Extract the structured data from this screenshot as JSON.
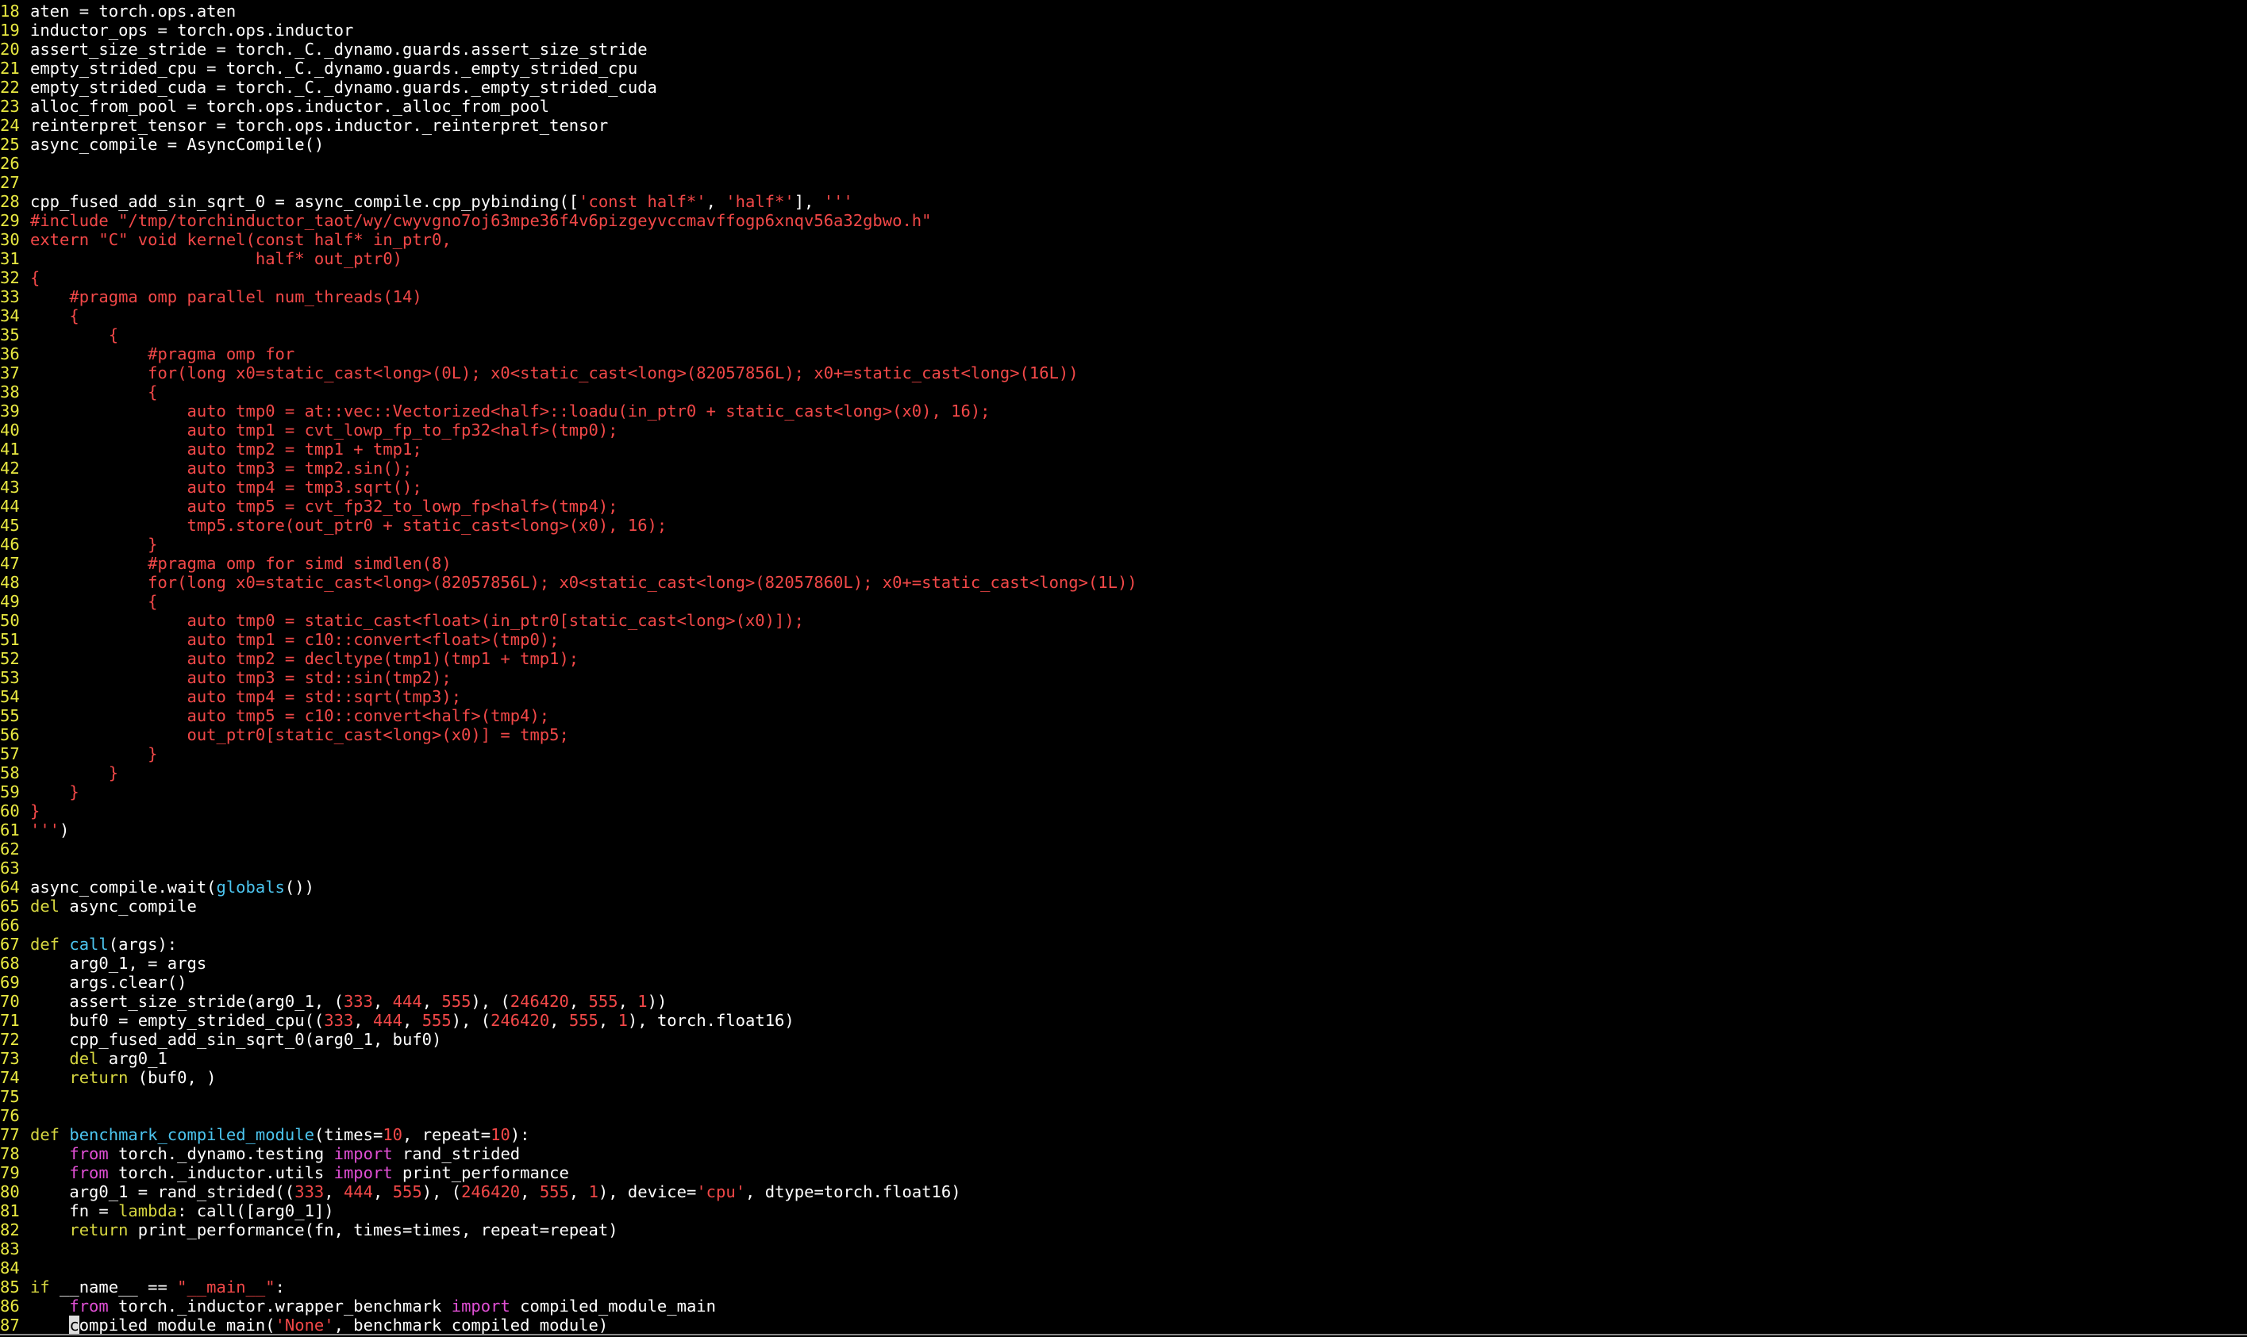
{
  "colors": {
    "background": "#000000",
    "line_number": "#e8e840",
    "default_text": "#ffffff",
    "string_literal": "#f24848",
    "number_literal": "#f24848",
    "keyword": "#d6d640",
    "import_keyword": "#e04fd4",
    "builtin": "#4cc4ee",
    "function_name": "#4cc4ee",
    "cursor": "#dcdcdc"
  },
  "editor": {
    "lines": [
      {
        "num": "18",
        "tokens": [
          {
            "t": "aten = torch.ops.aten",
            "c": "d"
          }
        ]
      },
      {
        "num": "19",
        "tokens": [
          {
            "t": "inductor_ops = torch.ops.inductor",
            "c": "d"
          }
        ]
      },
      {
        "num": "20",
        "tokens": [
          {
            "t": "assert_size_stride = torch._C._dynamo.guards.assert_size_stride",
            "c": "d"
          }
        ]
      },
      {
        "num": "21",
        "tokens": [
          {
            "t": "empty_strided_cpu = torch._C._dynamo.guards._empty_strided_cpu",
            "c": "d"
          }
        ]
      },
      {
        "num": "22",
        "tokens": [
          {
            "t": "empty_strided_cuda = torch._C._dynamo.guards._empty_strided_cuda",
            "c": "d"
          }
        ]
      },
      {
        "num": "23",
        "tokens": [
          {
            "t": "alloc_from_pool = torch.ops.inductor._alloc_from_pool",
            "c": "d"
          }
        ]
      },
      {
        "num": "24",
        "tokens": [
          {
            "t": "reinterpret_tensor = torch.ops.inductor._reinterpret_tensor",
            "c": "d"
          }
        ]
      },
      {
        "num": "25",
        "tokens": [
          {
            "t": "async_compile = AsyncCompile()",
            "c": "d"
          }
        ]
      },
      {
        "num": "26",
        "tokens": []
      },
      {
        "num": "27",
        "tokens": []
      },
      {
        "num": "28",
        "tokens": [
          {
            "t": "cpp_fused_add_sin_sqrt_0 = async_compile.cpp_pybinding([",
            "c": "d"
          },
          {
            "t": "'const half*'",
            "c": "s"
          },
          {
            "t": ", ",
            "c": "d"
          },
          {
            "t": "'half*'",
            "c": "s"
          },
          {
            "t": "], ",
            "c": "d"
          },
          {
            "t": "'''",
            "c": "s"
          }
        ]
      },
      {
        "num": "29",
        "tokens": [
          {
            "t": "#include \"/tmp/torchinductor_taot/wy/cwyvgno7oj63mpe36f4v6pizgeyvccmavffogp6xnqv56a32gbwo.h\"",
            "c": "s"
          }
        ]
      },
      {
        "num": "30",
        "tokens": [
          {
            "t": "extern \"C\" void kernel(const half* in_ptr0,",
            "c": "s"
          }
        ]
      },
      {
        "num": "31",
        "tokens": [
          {
            "t": "                       half* out_ptr0)",
            "c": "s"
          }
        ]
      },
      {
        "num": "32",
        "tokens": [
          {
            "t": "{",
            "c": "s"
          }
        ]
      },
      {
        "num": "33",
        "tokens": [
          {
            "t": "    #pragma omp parallel num_threads(14)",
            "c": "s"
          }
        ]
      },
      {
        "num": "34",
        "tokens": [
          {
            "t": "    {",
            "c": "s"
          }
        ]
      },
      {
        "num": "35",
        "tokens": [
          {
            "t": "        {",
            "c": "s"
          }
        ]
      },
      {
        "num": "36",
        "tokens": [
          {
            "t": "            #pragma omp for",
            "c": "s"
          }
        ]
      },
      {
        "num": "37",
        "tokens": [
          {
            "t": "            for(long x0=static_cast<long>(0L); x0<static_cast<long>(82057856L); x0+=static_cast<long>(16L))",
            "c": "s"
          }
        ]
      },
      {
        "num": "38",
        "tokens": [
          {
            "t": "            {",
            "c": "s"
          }
        ]
      },
      {
        "num": "39",
        "tokens": [
          {
            "t": "                auto tmp0 = at::vec::Vectorized<half>::loadu(in_ptr0 + static_cast<long>(x0), 16);",
            "c": "s"
          }
        ]
      },
      {
        "num": "40",
        "tokens": [
          {
            "t": "                auto tmp1 = cvt_lowp_fp_to_fp32<half>(tmp0);",
            "c": "s"
          }
        ]
      },
      {
        "num": "41",
        "tokens": [
          {
            "t": "                auto tmp2 = tmp1 + tmp1;",
            "c": "s"
          }
        ]
      },
      {
        "num": "42",
        "tokens": [
          {
            "t": "                auto tmp3 = tmp2.sin();",
            "c": "s"
          }
        ]
      },
      {
        "num": "43",
        "tokens": [
          {
            "t": "                auto tmp4 = tmp3.sqrt();",
            "c": "s"
          }
        ]
      },
      {
        "num": "44",
        "tokens": [
          {
            "t": "                auto tmp5 = cvt_fp32_to_lowp_fp<half>(tmp4);",
            "c": "s"
          }
        ]
      },
      {
        "num": "45",
        "tokens": [
          {
            "t": "                tmp5.store(out_ptr0 + static_cast<long>(x0), 16);",
            "c": "s"
          }
        ]
      },
      {
        "num": "46",
        "tokens": [
          {
            "t": "            }",
            "c": "s"
          }
        ]
      },
      {
        "num": "47",
        "tokens": [
          {
            "t": "            #pragma omp for simd simdlen(8)",
            "c": "s"
          }
        ]
      },
      {
        "num": "48",
        "tokens": [
          {
            "t": "            for(long x0=static_cast<long>(82057856L); x0<static_cast<long>(82057860L); x0+=static_cast<long>(1L))",
            "c": "s"
          }
        ]
      },
      {
        "num": "49",
        "tokens": [
          {
            "t": "            {",
            "c": "s"
          }
        ]
      },
      {
        "num": "50",
        "tokens": [
          {
            "t": "                auto tmp0 = static_cast<float>(in_ptr0[static_cast<long>(x0)]);",
            "c": "s"
          }
        ]
      },
      {
        "num": "51",
        "tokens": [
          {
            "t": "                auto tmp1 = c10::convert<float>(tmp0);",
            "c": "s"
          }
        ]
      },
      {
        "num": "52",
        "tokens": [
          {
            "t": "                auto tmp2 = decltype(tmp1)(tmp1 + tmp1);",
            "c": "s"
          }
        ]
      },
      {
        "num": "53",
        "tokens": [
          {
            "t": "                auto tmp3 = std::sin(tmp2);",
            "c": "s"
          }
        ]
      },
      {
        "num": "54",
        "tokens": [
          {
            "t": "                auto tmp4 = std::sqrt(tmp3);",
            "c": "s"
          }
        ]
      },
      {
        "num": "55",
        "tokens": [
          {
            "t": "                auto tmp5 = c10::convert<half>(tmp4);",
            "c": "s"
          }
        ]
      },
      {
        "num": "56",
        "tokens": [
          {
            "t": "                out_ptr0[static_cast<long>(x0)] = tmp5;",
            "c": "s"
          }
        ]
      },
      {
        "num": "57",
        "tokens": [
          {
            "t": "            }",
            "c": "s"
          }
        ]
      },
      {
        "num": "58",
        "tokens": [
          {
            "t": "        }",
            "c": "s"
          }
        ]
      },
      {
        "num": "59",
        "tokens": [
          {
            "t": "    }",
            "c": "s"
          }
        ]
      },
      {
        "num": "60",
        "tokens": [
          {
            "t": "}",
            "c": "s"
          }
        ]
      },
      {
        "num": "61",
        "tokens": [
          {
            "t": "'''",
            "c": "s"
          },
          {
            "t": ")",
            "c": "d"
          }
        ]
      },
      {
        "num": "62",
        "tokens": []
      },
      {
        "num": "63",
        "tokens": []
      },
      {
        "num": "64",
        "tokens": [
          {
            "t": "async_compile.wait(",
            "c": "d"
          },
          {
            "t": "globals",
            "c": "b"
          },
          {
            "t": "())",
            "c": "d"
          }
        ]
      },
      {
        "num": "65",
        "tokens": [
          {
            "t": "del",
            "c": "k"
          },
          {
            "t": " async_compile",
            "c": "d"
          }
        ]
      },
      {
        "num": "66",
        "tokens": []
      },
      {
        "num": "67",
        "tokens": [
          {
            "t": "def",
            "c": "k"
          },
          {
            "t": " ",
            "c": "d"
          },
          {
            "t": "call",
            "c": "f"
          },
          {
            "t": "(args):",
            "c": "d"
          }
        ]
      },
      {
        "num": "68",
        "tokens": [
          {
            "t": "    arg0_1, = args",
            "c": "d"
          }
        ]
      },
      {
        "num": "69",
        "tokens": [
          {
            "t": "    args.clear()",
            "c": "d"
          }
        ]
      },
      {
        "num": "70",
        "tokens": [
          {
            "t": "    assert_size_stride(arg0_1, (",
            "c": "d"
          },
          {
            "t": "333",
            "c": "n"
          },
          {
            "t": ", ",
            "c": "d"
          },
          {
            "t": "444",
            "c": "n"
          },
          {
            "t": ", ",
            "c": "d"
          },
          {
            "t": "555",
            "c": "n"
          },
          {
            "t": "), (",
            "c": "d"
          },
          {
            "t": "246420",
            "c": "n"
          },
          {
            "t": ", ",
            "c": "d"
          },
          {
            "t": "555",
            "c": "n"
          },
          {
            "t": ", ",
            "c": "d"
          },
          {
            "t": "1",
            "c": "n"
          },
          {
            "t": "))",
            "c": "d"
          }
        ]
      },
      {
        "num": "71",
        "tokens": [
          {
            "t": "    buf0 = empty_strided_cpu((",
            "c": "d"
          },
          {
            "t": "333",
            "c": "n"
          },
          {
            "t": ", ",
            "c": "d"
          },
          {
            "t": "444",
            "c": "n"
          },
          {
            "t": ", ",
            "c": "d"
          },
          {
            "t": "555",
            "c": "n"
          },
          {
            "t": "), (",
            "c": "d"
          },
          {
            "t": "246420",
            "c": "n"
          },
          {
            "t": ", ",
            "c": "d"
          },
          {
            "t": "555",
            "c": "n"
          },
          {
            "t": ", ",
            "c": "d"
          },
          {
            "t": "1",
            "c": "n"
          },
          {
            "t": "), torch.float16)",
            "c": "d"
          }
        ]
      },
      {
        "num": "72",
        "tokens": [
          {
            "t": "    cpp_fused_add_sin_sqrt_0(arg0_1, buf0)",
            "c": "d"
          }
        ]
      },
      {
        "num": "73",
        "tokens": [
          {
            "t": "    ",
            "c": "d"
          },
          {
            "t": "del",
            "c": "k"
          },
          {
            "t": " arg0_1",
            "c": "d"
          }
        ]
      },
      {
        "num": "74",
        "tokens": [
          {
            "t": "    ",
            "c": "d"
          },
          {
            "t": "return",
            "c": "k"
          },
          {
            "t": " (buf0, )",
            "c": "d"
          }
        ]
      },
      {
        "num": "75",
        "tokens": []
      },
      {
        "num": "76",
        "tokens": []
      },
      {
        "num": "77",
        "tokens": [
          {
            "t": "def",
            "c": "k"
          },
          {
            "t": " ",
            "c": "d"
          },
          {
            "t": "benchmark_compiled_module",
            "c": "f"
          },
          {
            "t": "(times=",
            "c": "d"
          },
          {
            "t": "10",
            "c": "n"
          },
          {
            "t": ", repeat=",
            "c": "d"
          },
          {
            "t": "10",
            "c": "n"
          },
          {
            "t": "):",
            "c": "d"
          }
        ]
      },
      {
        "num": "78",
        "tokens": [
          {
            "t": "    ",
            "c": "d"
          },
          {
            "t": "from",
            "c": "i"
          },
          {
            "t": " torch._dynamo.testing ",
            "c": "d"
          },
          {
            "t": "import",
            "c": "i"
          },
          {
            "t": " rand_strided",
            "c": "d"
          }
        ]
      },
      {
        "num": "79",
        "tokens": [
          {
            "t": "    ",
            "c": "d"
          },
          {
            "t": "from",
            "c": "i"
          },
          {
            "t": " torch._inductor.utils ",
            "c": "d"
          },
          {
            "t": "import",
            "c": "i"
          },
          {
            "t": " print_performance",
            "c": "d"
          }
        ]
      },
      {
        "num": "80",
        "tokens": [
          {
            "t": "    arg0_1 = rand_strided((",
            "c": "d"
          },
          {
            "t": "333",
            "c": "n"
          },
          {
            "t": ", ",
            "c": "d"
          },
          {
            "t": "444",
            "c": "n"
          },
          {
            "t": ", ",
            "c": "d"
          },
          {
            "t": "555",
            "c": "n"
          },
          {
            "t": "), (",
            "c": "d"
          },
          {
            "t": "246420",
            "c": "n"
          },
          {
            "t": ", ",
            "c": "d"
          },
          {
            "t": "555",
            "c": "n"
          },
          {
            "t": ", ",
            "c": "d"
          },
          {
            "t": "1",
            "c": "n"
          },
          {
            "t": "), device=",
            "c": "d"
          },
          {
            "t": "'cpu'",
            "c": "s"
          },
          {
            "t": ", dtype=torch.float16)",
            "c": "d"
          }
        ]
      },
      {
        "num": "81",
        "tokens": [
          {
            "t": "    fn = ",
            "c": "d"
          },
          {
            "t": "lambda",
            "c": "k"
          },
          {
            "t": ": call([arg0_1])",
            "c": "d"
          }
        ]
      },
      {
        "num": "82",
        "tokens": [
          {
            "t": "    ",
            "c": "d"
          },
          {
            "t": "return",
            "c": "k"
          },
          {
            "t": " print_performance(fn, times=times, repeat=repeat)",
            "c": "d"
          }
        ]
      },
      {
        "num": "83",
        "tokens": []
      },
      {
        "num": "84",
        "tokens": []
      },
      {
        "num": "85",
        "tokens": [
          {
            "t": "if",
            "c": "k"
          },
          {
            "t": " __name__ == ",
            "c": "d"
          },
          {
            "t": "\"__main__\"",
            "c": "s"
          },
          {
            "t": ":",
            "c": "d"
          }
        ]
      },
      {
        "num": "86",
        "tokens": [
          {
            "t": "    ",
            "c": "d"
          },
          {
            "t": "from",
            "c": "i"
          },
          {
            "t": " torch._inductor.wrapper_benchmark ",
            "c": "d"
          },
          {
            "t": "import",
            "c": "i"
          },
          {
            "t": " compiled_module_main",
            "c": "d"
          }
        ]
      },
      {
        "num": "87",
        "tokens": [
          {
            "t": "    ",
            "c": "d"
          },
          {
            "t": "c",
            "c": "cursor"
          },
          {
            "t": "ompiled_module_main(",
            "c": "d"
          },
          {
            "t": "'None'",
            "c": "s"
          },
          {
            "t": ", benchmark_compiled_module)",
            "c": "d"
          }
        ]
      }
    ]
  }
}
